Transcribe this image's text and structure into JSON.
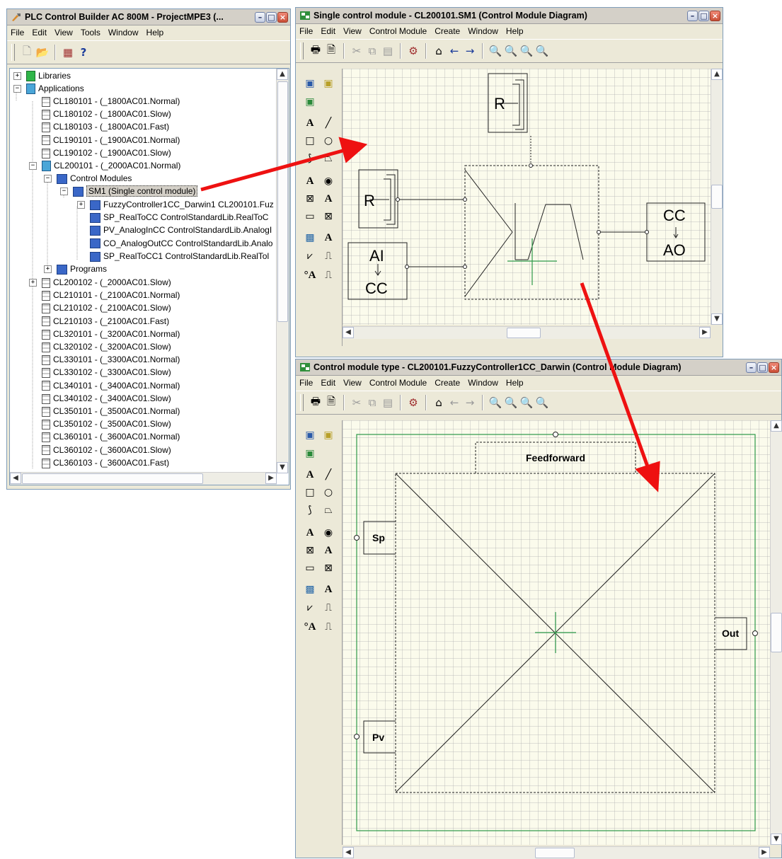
{
  "main_window": {
    "title": "PLC Control Builder AC 800M - ProjectMPE3   (...",
    "menu": [
      "File",
      "Edit",
      "View",
      "Tools",
      "Window",
      "Help"
    ],
    "tree": {
      "libraries": "Libraries",
      "applications": "Applications",
      "items_a": [
        "CL180101 - (_1800AC01.Normal)",
        "CL180102 - (_1800AC01.Slow)",
        "CL180103 - (_1800AC01.Fast)",
        "CL190101 - (_1900AC01.Normal)",
        "CL190102 - (_1900AC01.Slow)"
      ],
      "cl200101": "CL200101 - (_2000AC01.Normal)",
      "control_modules": "Control Modules",
      "sm1": "SM1  (Single control module)",
      "modules": [
        "FuzzyController1CC_Darwin1   CL200101.Fuz",
        "SP_RealToCC   ControlStandardLib.RealToC",
        "PV_AnalogInCC   ControlStandardLib.AnalogI",
        "CO_AnalogOutCC   ControlStandardLib.Analo",
        "SP_RealToCC1   ControlStandardLib.RealTol"
      ],
      "programs": "Programs",
      "items_b": [
        "CL200102 - (_2000AC01.Slow)",
        "CL210101 - (_2100AC01.Normal)",
        "CL210102 - (_2100AC01.Slow)",
        "CL210103 - (_2100AC01.Fast)",
        "CL320101 - (_3200AC01.Normal)",
        "CL320102 - (_3200AC01.Slow)",
        "CL330101 - (_3300AC01.Normal)",
        "CL330102 - (_3300AC01.Slow)",
        "CL340101 - (_3400AC01.Normal)",
        "CL340102 - (_3400AC01.Slow)",
        "CL350101 - (_3500AC01.Normal)",
        "CL350102 - (_3500AC01.Slow)",
        "CL360101 - (_3600AC01.Normal)",
        "CL360102 - (_3600AC01.Slow)",
        "CL360103 - (_3600AC01.Fast)"
      ]
    }
  },
  "sm_window": {
    "title": "Single control module - CL200101.SM1 (Control Module Diagram)",
    "menu": [
      "File",
      "Edit",
      "View",
      "Control Module",
      "Create",
      "Window",
      "Help"
    ],
    "diagram": {
      "r_label": "R",
      "ai": "AI",
      "cc": "CC",
      "ao": "AO"
    }
  },
  "cmt_window": {
    "title": "Control module type - CL200101.FuzzyController1CC_Darwin (Control Module Diagram)",
    "menu": [
      "File",
      "Edit",
      "View",
      "Control Module",
      "Create",
      "Window",
      "Help"
    ],
    "diagram": {
      "feedforward": "Feedforward",
      "sp": "Sp",
      "pv": "Pv",
      "out": "Out"
    }
  },
  "palette": {
    "text_tool": "A",
    "label_a": "A",
    "output_a": "°A"
  },
  "colors": {
    "arrow": "#ee1111",
    "canvas": "#fbfbec",
    "diagram_frame": "#2e9a4a",
    "cursor": "#2e9a4a"
  }
}
